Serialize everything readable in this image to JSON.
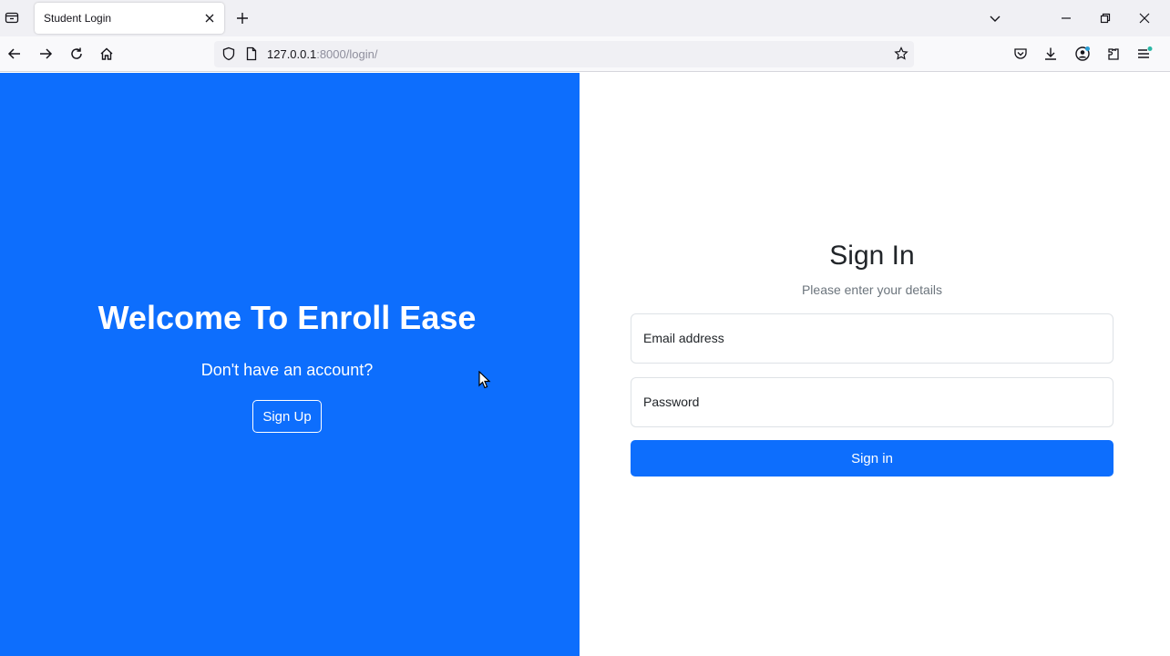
{
  "browser": {
    "tab_title": "Student Login",
    "url_host": "127.0.0.1",
    "url_rest": ":8000/login/"
  },
  "left": {
    "heading": "Welcome To Enroll Ease",
    "prompt": "Don't have an account?",
    "signup_label": "Sign Up"
  },
  "right": {
    "title": "Sign In",
    "subtitle": "Please enter your details",
    "email_label": "Email address",
    "password_label": "Password",
    "signin_label": "Sign in"
  },
  "colors": {
    "primary": "#0d6efd",
    "chrome_bg": "#f0f0f4"
  }
}
